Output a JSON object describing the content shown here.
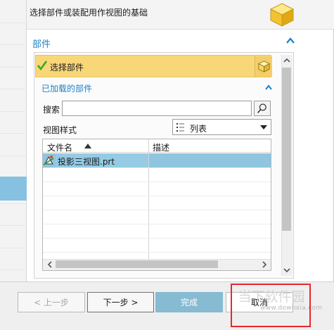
{
  "header": {
    "description": "选择部件或装配用作视图的基础",
    "icon": "yellow-cube-icon"
  },
  "part_section": {
    "title": "部件",
    "collapse_icon": "chevron-up-icon"
  },
  "select_part": {
    "label": "选择部件",
    "status_icon": "green-check-icon",
    "button_icon": "yellow-cube-icon"
  },
  "loaded_parts": {
    "title": "已加载的部件",
    "collapse_icon": "chevron-up-icon",
    "search": {
      "label": "搜索",
      "value": "",
      "button_icon": "magnifier-icon"
    },
    "view_style": {
      "label": "视图样式",
      "selected": "列表",
      "icon": "list-view-icon"
    },
    "table": {
      "columns": [
        "文件名",
        "描述"
      ],
      "sort_column": "文件名",
      "sort_direction": "ascending",
      "rows": [
        {
          "name": "投影三视图.prt",
          "description": "",
          "icon": "part-file-icon",
          "selected": true
        }
      ]
    }
  },
  "footer": {
    "back": "< 上一步",
    "next": "下一步 >",
    "finish": "完成",
    "cancel": "取消"
  },
  "watermark": {
    "brand": "当下软件园",
    "domain": "www.downxia.com"
  },
  "colors": {
    "accent": "#1f7fc6",
    "selection_highlight": "#f8d779",
    "row_selected": "#8fc5df",
    "finish_button": "#86bbd2",
    "annotation_red": "#e8262e"
  }
}
